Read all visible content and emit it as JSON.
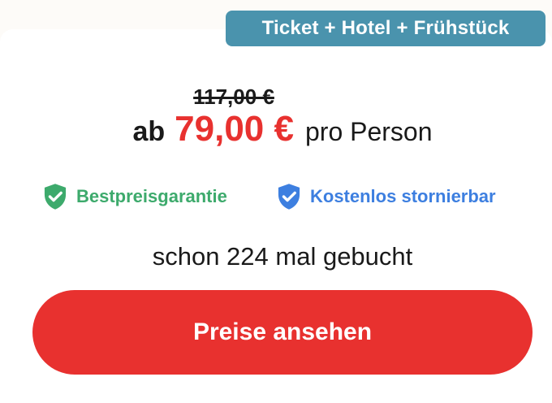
{
  "offer": {
    "badge": "Ticket + Hotel + Frühstück",
    "old_price": "117,00 €",
    "prefix": "ab",
    "price": "79,00 €",
    "suffix": "pro Person"
  },
  "features": [
    {
      "label": "Bestpreisgarantie",
      "icon": "shield-check-icon",
      "color": "#3daa6c"
    },
    {
      "label": "Kostenlos stornierbar",
      "icon": "shield-check-icon",
      "color": "#3d7fe0"
    }
  ],
  "booked_text": "schon 224 mal gebucht",
  "cta_label": "Preise ansehen",
  "colors": {
    "badge": "#4a93ad",
    "price": "#e8312f",
    "cta": "#e8312f"
  }
}
